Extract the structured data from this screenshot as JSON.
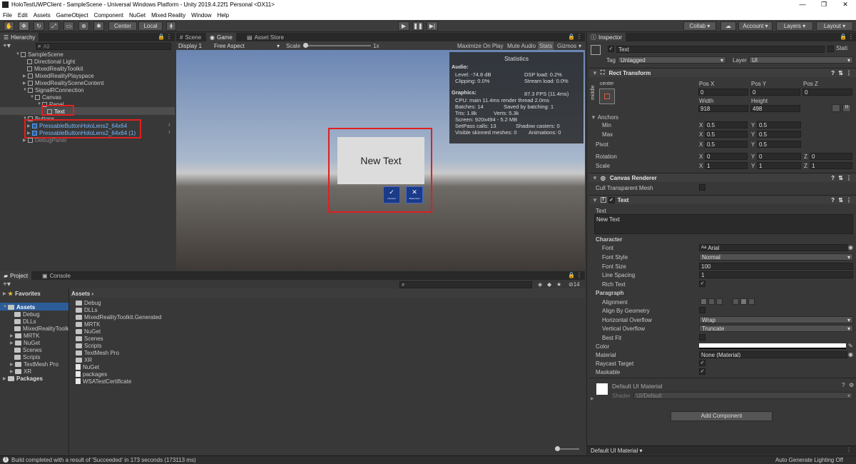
{
  "window": {
    "title": "HoloTestUWPClient - SampleScene - Universal Windows Platform - Unity 2019.4.22f1 Personal <DX11>",
    "minimize": "—",
    "maximize": "❐",
    "close": "✕"
  },
  "menu": [
    "File",
    "Edit",
    "Assets",
    "GameObject",
    "Component",
    "NuGet",
    "Mixed Reality",
    "Window",
    "Help"
  ],
  "toolbar": {
    "pivot": "Center",
    "space": "Local",
    "collab": "Collab ▾",
    "account": "Account",
    "layers": "Layers",
    "layout": "Layout"
  },
  "hierarchy": {
    "tab": "Hierarchy",
    "search_placeholder": "All",
    "items": [
      {
        "label": "SampleScene"
      },
      {
        "label": "Directional Light"
      },
      {
        "label": "MixedRealityToolkit"
      },
      {
        "label": "MixedRealityPlayspace"
      },
      {
        "label": "MixedRealitySceneContent"
      },
      {
        "label": "SignalRConnection"
      },
      {
        "label": "Canvas"
      },
      {
        "label": "Panel"
      },
      {
        "label": "Text"
      },
      {
        "label": "Buttons"
      },
      {
        "label": "PressableButtonHoloLens2_64x64"
      },
      {
        "label": "PressableButtonHoloLens2_64x64 (1)"
      },
      {
        "label": "DebugPanel"
      }
    ]
  },
  "scene_tabs": {
    "scene": "Scene",
    "game": "Game",
    "asset_store": "Asset Store"
  },
  "game_toolbar": {
    "display": "Display 1",
    "aspect": "Free Aspect",
    "scale_label": "Scale",
    "scale_value": "1x",
    "maximize_on_play": "Maximize On Play",
    "mute_audio": "Mute Audio",
    "stats": "Stats",
    "gizmos": "Gizmos"
  },
  "stats": {
    "title": "Statistics",
    "audio_heading": "Audio:",
    "level": "Level: -74.8 dB",
    "clipping": "Clipping: 0.0%",
    "dsp": "DSP load: 0.2%",
    "stream": "Stream load: 0.0%",
    "graphics_heading": "Graphics:",
    "fps": "87.3 FPS (11.4ms)",
    "cpu": "CPU: main 11.4ms  render thread 2.0ms",
    "batches": "Batches: 14",
    "saved": "Saved by batching: 1",
    "tris": "Tris: 1.8k",
    "verts": "Verts: 5.3k",
    "screen": "Screen: 920x494 - 5.2 MB",
    "setpass": "SetPass calls: 13",
    "shadow": "Shadow casters: 0",
    "skinned": "Visible skinned meshes: 0",
    "animations": "Animations: 0"
  },
  "game_content": {
    "text": "New Text",
    "btn1_label": "Connect",
    "btn2_label": "Disconnect"
  },
  "inspector": {
    "tab": "Inspector",
    "object_name": "Text",
    "static_label": "Stati",
    "tag_label": "Tag",
    "tag_value": "Untagged",
    "layer_label": "Layer",
    "layer_value": "UI",
    "rect_transform": {
      "title": "Rect Transform",
      "anchor_preset": "center",
      "side_label": "middle",
      "pos_x_label": "Pos X",
      "pos_y_label": "Pos Y",
      "pos_z_label": "Pos Z",
      "pos_x": "0",
      "pos_y": "0",
      "pos_z": "0",
      "width_label": "Width",
      "height_label": "Height",
      "width": "918",
      "height": "498",
      "anchors_label": "Anchors",
      "min_label": "Min",
      "max_label": "Max",
      "pivot_label": "Pivot",
      "min_x": "0.5",
      "min_y": "0.5",
      "max_x": "0.5",
      "max_y": "0.5",
      "pivot_x": "0.5",
      "pivot_y": "0.5",
      "rotation_label": "Rotation",
      "rot_x": "0",
      "rot_y": "0",
      "rot_z": "0",
      "scale_label": "Scale",
      "scale_x": "1",
      "scale_y": "1",
      "scale_z": "1",
      "axis_x": "X",
      "axis_y": "Y",
      "axis_z": "Z",
      "blueprint": "R"
    },
    "canvas_renderer": {
      "title": "Canvas Renderer",
      "cull_label": "Cull Transparent Mesh"
    },
    "text_component": {
      "title": "Text",
      "text_label": "Text",
      "text_value": "New Text",
      "character_heading": "Character",
      "font_label": "Font",
      "font_value": "Arial",
      "font_prefix": "Aa",
      "font_style_label": "Font Style",
      "font_style_value": "Normal",
      "font_size_label": "Font Size",
      "font_size_value": "100",
      "line_spacing_label": "Line Spacing",
      "line_spacing_value": "1",
      "rich_text_label": "Rich Text",
      "paragraph_heading": "Paragraph",
      "alignment_label": "Alignment",
      "align_by_geom_label": "Align By Geometry",
      "h_overflow_label": "Horizontal Overflow",
      "h_overflow_value": "Wrap",
      "v_overflow_label": "Vertical Overflow",
      "v_overflow_value": "Truncate",
      "best_fit_label": "Best Fit",
      "color_label": "Color",
      "material_label": "Material",
      "material_value": "None (Material)",
      "raycast_label": "Raycast Target",
      "maskable_label": "Maskable"
    },
    "material": {
      "name": "Default UI Material",
      "shader_label": "Shader",
      "shader_value": "UI/Default"
    },
    "add_component": "Add Component",
    "footer": "Default UI Material ▾"
  },
  "project": {
    "tab_project": "Project",
    "tab_console": "Console",
    "favorites": "Favorites",
    "assets_root": "Assets",
    "packages": "Packages",
    "breadcrumb": "Assets",
    "hidden_count": "14",
    "tree": [
      "Debug",
      "DLLs",
      "MixedRealityToolk",
      "MRTK",
      "NuGet",
      "Scenes",
      "Scripts",
      "TextMesh Pro",
      "XR"
    ],
    "files": [
      {
        "label": "Debug",
        "kind": "folder"
      },
      {
        "label": "DLLs",
        "kind": "folder"
      },
      {
        "label": "MixedRealityToolkit.Generated",
        "kind": "folder"
      },
      {
        "label": "MRTK",
        "kind": "folder"
      },
      {
        "label": "NuGet",
        "kind": "folder"
      },
      {
        "label": "Scenes",
        "kind": "folder"
      },
      {
        "label": "Scripts",
        "kind": "folder"
      },
      {
        "label": "TextMesh Pro",
        "kind": "folder"
      },
      {
        "label": "XR",
        "kind": "folder"
      },
      {
        "label": "NuGet",
        "kind": "file"
      },
      {
        "label": "packages",
        "kind": "file"
      },
      {
        "label": "WSATestCertificate",
        "kind": "file"
      }
    ]
  },
  "status": {
    "message": "Build completed with a result of 'Succeeded' in 173 seconds (173113 ms)",
    "lighting": "Auto Generate Lighting Off"
  },
  "colors": {
    "selection_blue": "#2d5d99",
    "highlight_red": "#e02020",
    "panel_bg": "#383838"
  }
}
